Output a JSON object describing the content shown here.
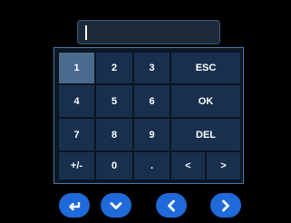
{
  "display": {
    "value": ""
  },
  "keypad": {
    "keys": {
      "one": "1",
      "two": "2",
      "three": "3",
      "esc": "ESC",
      "four": "4",
      "five": "5",
      "six": "6",
      "ok": "OK",
      "seven": "7",
      "eight": "8",
      "nine": "9",
      "del": "DEL",
      "plus_minus": "+/-",
      "zero": "0",
      "dot": ".",
      "left": "<",
      "right": ">"
    }
  },
  "nav": {
    "buttons": [
      "enter-icon",
      "chevron-down-icon",
      "chevron-left-icon",
      "chevron-right-icon"
    ]
  },
  "colors": {
    "background": "#000000",
    "key": "#18304d",
    "key_active": "#4a6a8e",
    "nav_button": "#1f6ad8",
    "keypad_border": "#4a7aa8"
  }
}
